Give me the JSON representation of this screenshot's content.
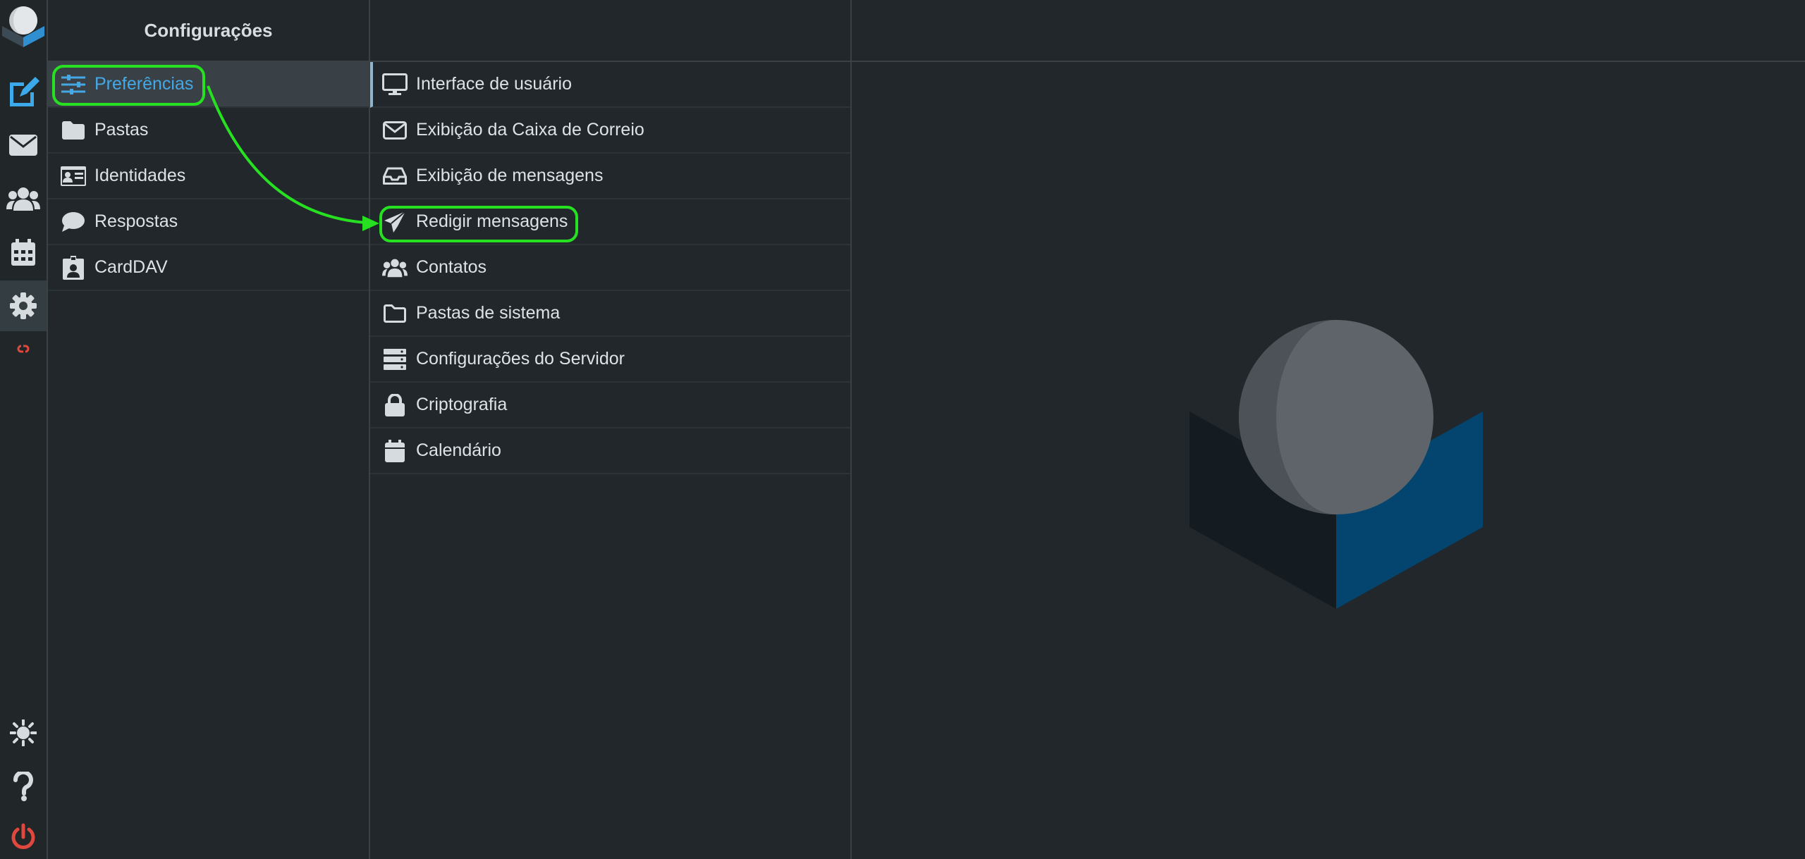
{
  "panel1": {
    "title": "Configurações",
    "items": [
      {
        "label": "Preferências",
        "icon": "sliders-icon",
        "selected": true
      },
      {
        "label": "Pastas",
        "icon": "folder-icon"
      },
      {
        "label": "Identidades",
        "icon": "id-card-icon"
      },
      {
        "label": "Respostas",
        "icon": "comment-icon"
      },
      {
        "label": "CardDAV",
        "icon": "contact-badge-icon"
      }
    ]
  },
  "panel2": {
    "items": [
      {
        "label": "Interface de usuário",
        "icon": "monitor-icon",
        "selected": true
      },
      {
        "label": "Exibição da Caixa de Correio",
        "icon": "envelope-icon"
      },
      {
        "label": "Exibição de mensagens",
        "icon": "inbox-icon"
      },
      {
        "label": "Redigir mensagens",
        "icon": "paper-plane-icon"
      },
      {
        "label": "Contatos",
        "icon": "users-icon"
      },
      {
        "label": "Pastas de sistema",
        "icon": "folder-outline-icon"
      },
      {
        "label": "Configurações do Servidor",
        "icon": "server-icon"
      },
      {
        "label": "Criptografia",
        "icon": "lock-icon"
      },
      {
        "label": "Calendário",
        "icon": "calendar-icon"
      }
    ]
  },
  "rail": [
    {
      "icon": "logo-icon"
    },
    {
      "icon": "compose-icon"
    },
    {
      "icon": "mail-icon"
    },
    {
      "icon": "contacts-icon"
    },
    {
      "icon": "calendar-icon"
    },
    {
      "icon": "settings-gear-icon",
      "active": true
    },
    {
      "icon": "link-icon"
    },
    {
      "icon": "theme-sun-icon"
    },
    {
      "icon": "help-icon"
    },
    {
      "icon": "logout-power-icon"
    }
  ],
  "colors": {
    "background": "#21272b",
    "accent": "#44a8e6",
    "highlight": "#27e021",
    "danger": "#e0483e",
    "logo_blue": "#04456f"
  }
}
